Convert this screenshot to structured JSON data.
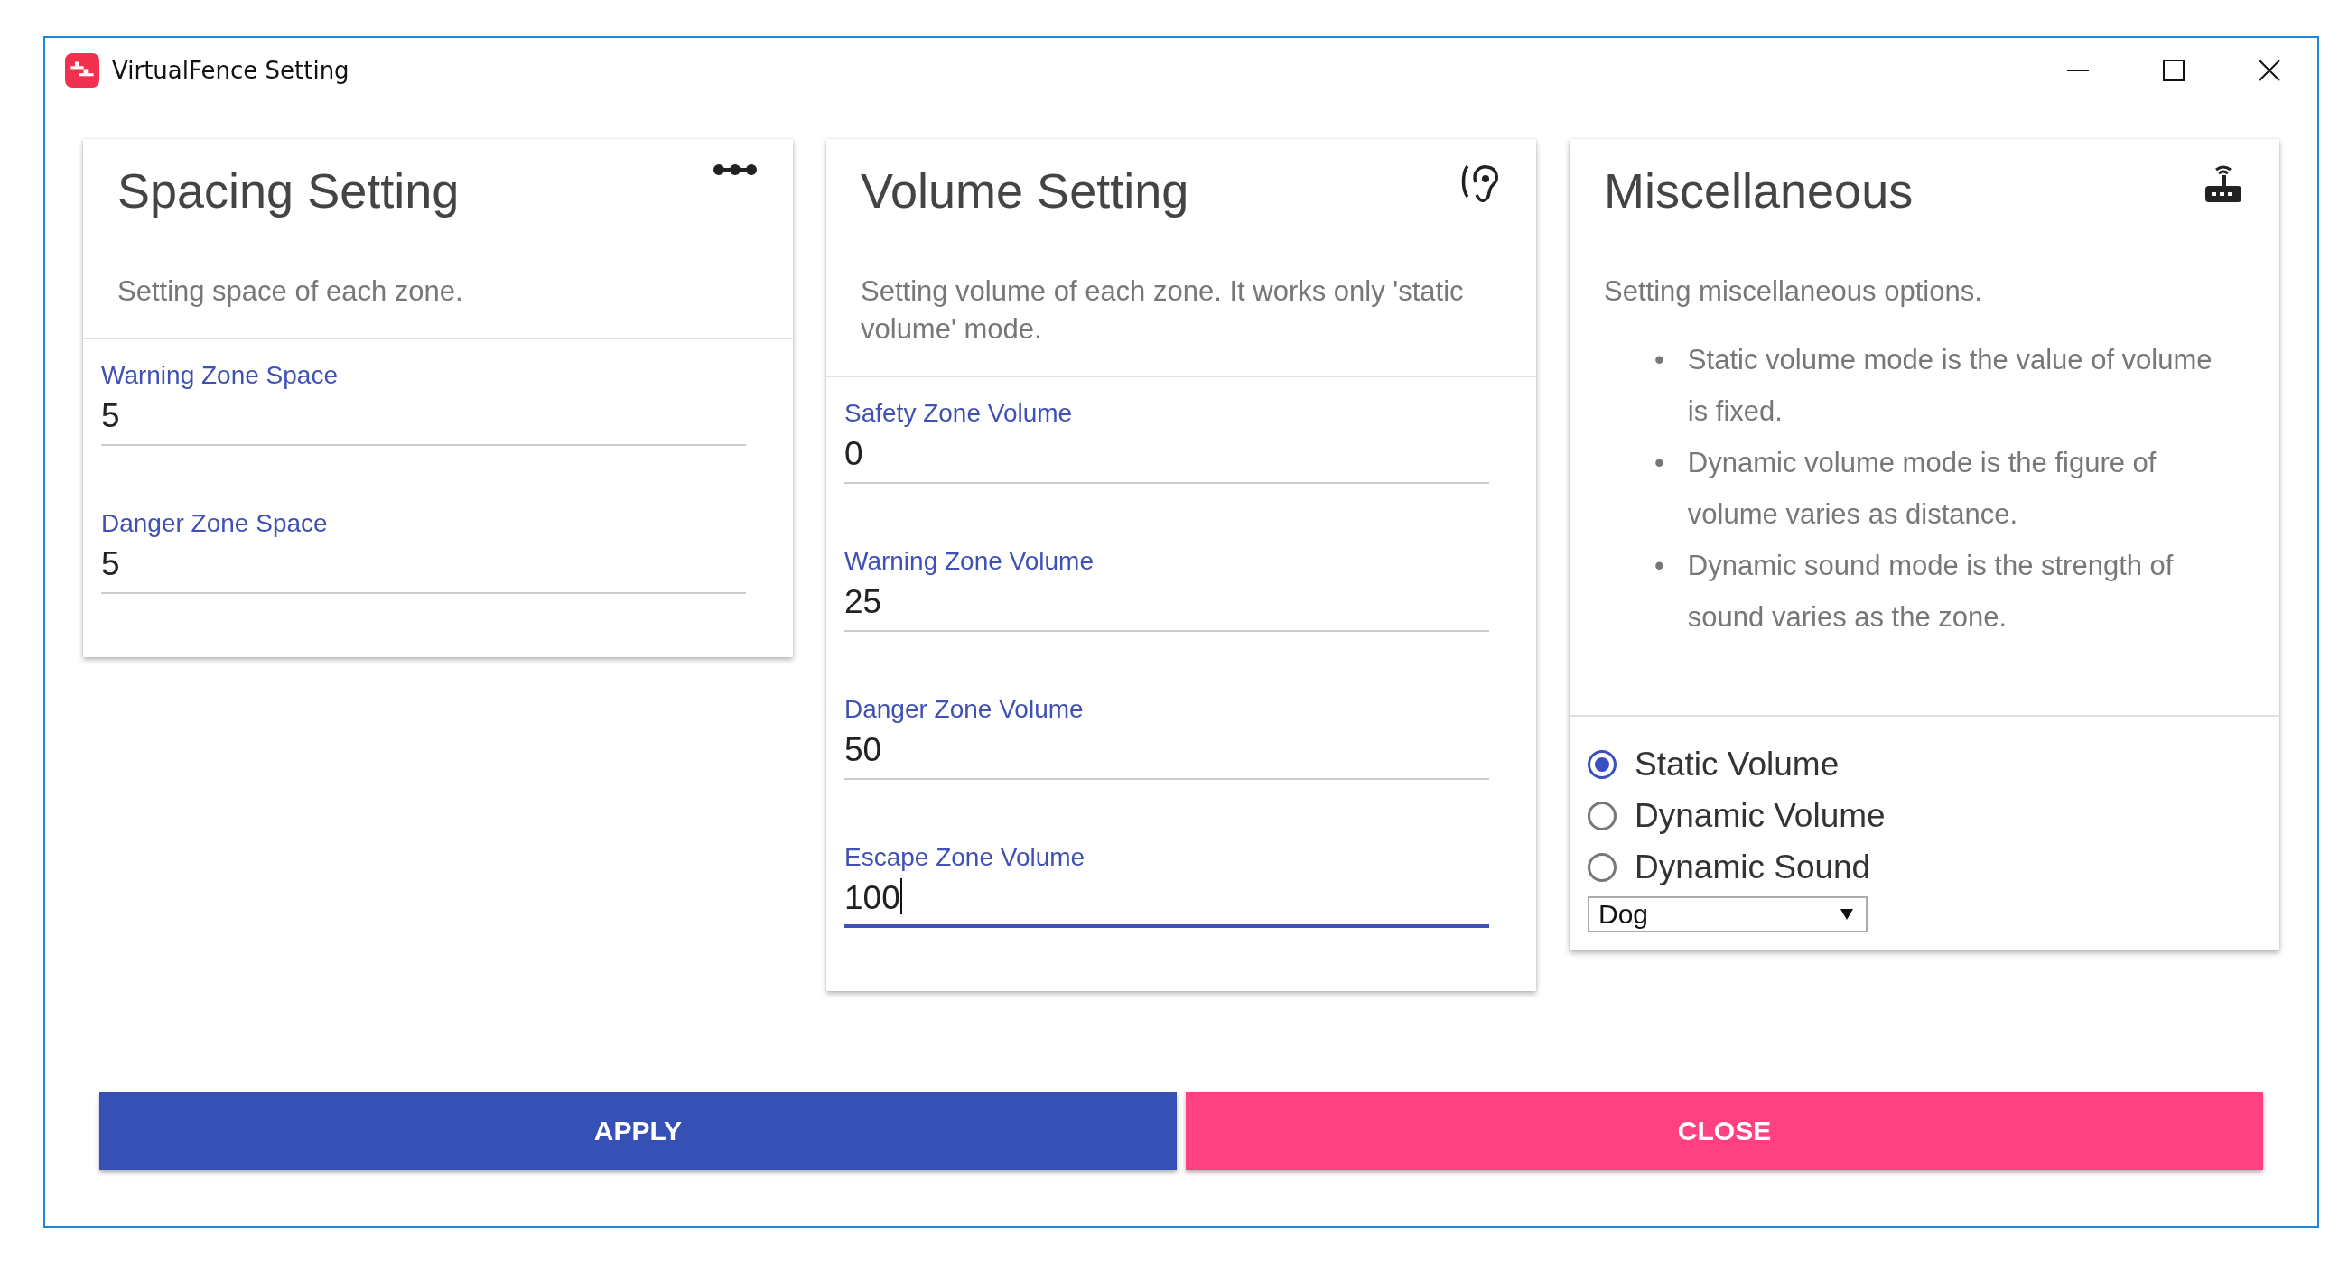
{
  "window": {
    "title": "VirtualFence Setting"
  },
  "cards": [
    {
      "kind": "fields",
      "title": "Spacing Setting",
      "description": "Setting space of each zone.",
      "fields": [
        {
          "label": "Warning Zone Space",
          "value": "5",
          "focused": false
        },
        {
          "label": "Danger Zone Space",
          "value": "5",
          "focused": false
        }
      ]
    },
    {
      "kind": "fields",
      "title": "Volume Setting",
      "description": "Setting volume of each zone. It works only 'static volume' mode.",
      "fields": [
        {
          "label": "Safety Zone Volume",
          "value": "0",
          "focused": false
        },
        {
          "label": "Warning Zone Volume",
          "value": "25",
          "focused": false
        },
        {
          "label": "Danger Zone Volume",
          "value": "50",
          "focused": false
        },
        {
          "label": "Escape Zone Volume",
          "value": "100",
          "focused": true
        }
      ]
    },
    {
      "kind": "options",
      "title": "Miscellaneous",
      "description": "Setting miscellaneous options.",
      "notes": [
        {
          "bullet": "•",
          "text": "Static volume mode is the value of volume is fixed."
        },
        {
          "bullet": "•",
          "text": "Dynamic volume mode is the figure of volume varies as distance."
        },
        {
          "bullet": "•",
          "text": "Dynamic sound mode is the strength of sound varies as the zone."
        }
      ],
      "options": [
        {
          "label": "Static Volume",
          "selected": true
        },
        {
          "label": "Dynamic Volume",
          "selected": false
        },
        {
          "label": "Dynamic Sound",
          "selected": false
        }
      ],
      "select": {
        "value": "Dog"
      }
    }
  ],
  "buttons": [
    {
      "label": "APPLY",
      "kind": "primary"
    },
    {
      "label": "CLOSE",
      "kind": "danger"
    }
  ]
}
